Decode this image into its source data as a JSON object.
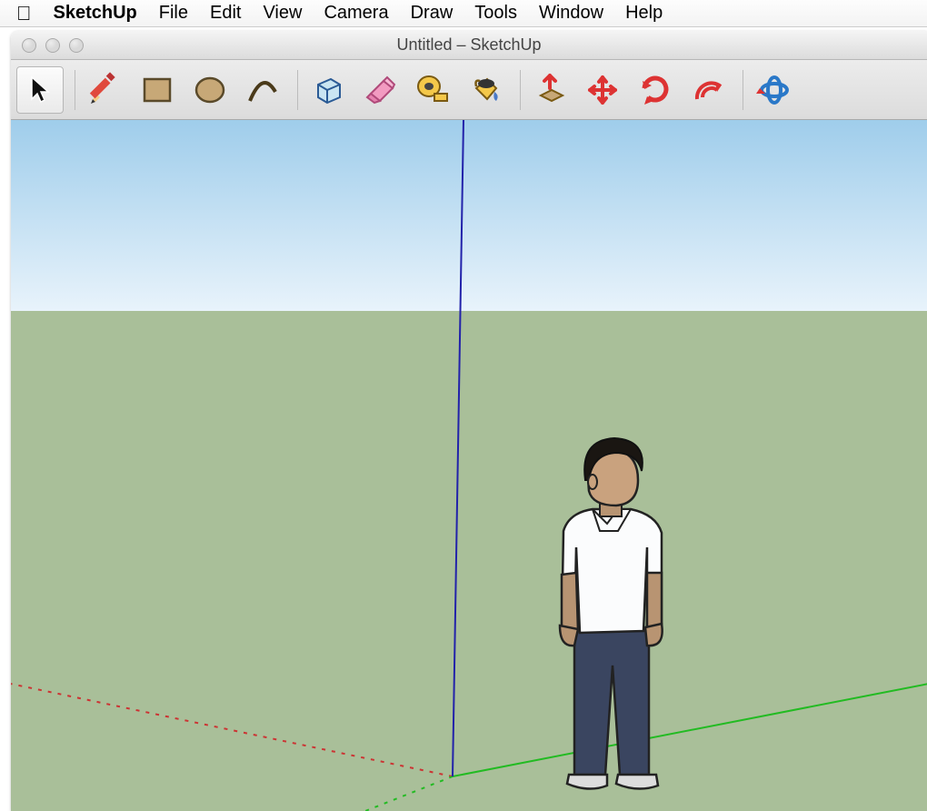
{
  "menubar": {
    "app": "SketchUp",
    "items": [
      "File",
      "Edit",
      "View",
      "Camera",
      "Draw",
      "Tools",
      "Window",
      "Help"
    ]
  },
  "window": {
    "title": "Untitled – SketchUp"
  },
  "toolbar": {
    "tools": [
      {
        "name": "select-tool",
        "label": "Select",
        "selected": true
      },
      {
        "name": "line-tool",
        "label": "Line"
      },
      {
        "name": "rectangle-tool",
        "label": "Rectangle"
      },
      {
        "name": "circle-tool",
        "label": "Circle"
      },
      {
        "name": "arc-tool",
        "label": "Arc"
      },
      {
        "sep": true
      },
      {
        "name": "make-component-tool",
        "label": "Make Component"
      },
      {
        "name": "eraser-tool",
        "label": "Eraser"
      },
      {
        "name": "tape-measure-tool",
        "label": "Tape Measure"
      },
      {
        "name": "paint-bucket-tool",
        "label": "Paint Bucket"
      },
      {
        "sep": true
      },
      {
        "name": "push-pull-tool",
        "label": "Push/Pull"
      },
      {
        "name": "move-tool",
        "label": "Move"
      },
      {
        "name": "rotate-tool",
        "label": "Rotate"
      },
      {
        "name": "offset-tool",
        "label": "Offset"
      },
      {
        "sep": true
      },
      {
        "name": "orbit-tool",
        "label": "Orbit"
      }
    ]
  },
  "viewport": {
    "axes": {
      "x_color": "#d22",
      "y_color": "#2b2",
      "z_color": "#22a"
    },
    "ground_color": "#a9bf99",
    "sky_top": "#9fcdeb",
    "sky_bottom": "#e8f3fb",
    "scale_figure": "Derrick"
  }
}
